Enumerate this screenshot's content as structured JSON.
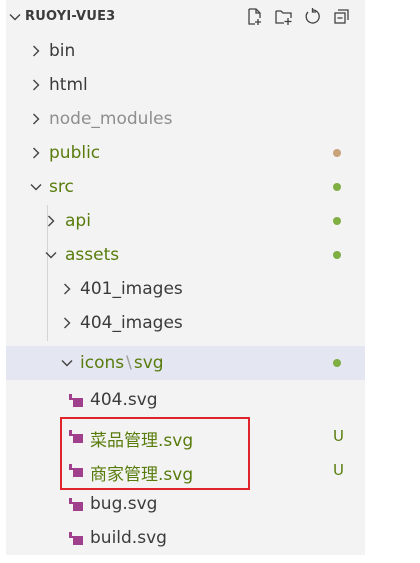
{
  "explorer": {
    "title": "RUOYI-VUE3",
    "header_actions": [
      "new-file-icon",
      "new-folder-icon",
      "refresh-icon",
      "collapse-all-icon"
    ],
    "colors": {
      "untracked": "#587c0c",
      "ignored": "#8e8e90",
      "modified_dot_brown": "#c8a27a",
      "svg_icon": "#a0408c",
      "highlight_box": "#e0242c"
    }
  },
  "tree": [
    {
      "label": "bin",
      "type": "folder",
      "expanded": false
    },
    {
      "label": "html",
      "type": "folder",
      "expanded": false
    },
    {
      "label": "node_modules",
      "type": "folder",
      "expanded": false
    },
    {
      "label": "public",
      "type": "folder",
      "expanded": false
    },
    {
      "label": "src",
      "type": "folder",
      "expanded": true
    },
    {
      "label": "api",
      "type": "folder",
      "expanded": false
    },
    {
      "label": "assets",
      "type": "folder",
      "expanded": true
    },
    {
      "label": "401_images",
      "type": "folder",
      "expanded": false
    },
    {
      "label": "404_images",
      "type": "folder",
      "expanded": false
    },
    {
      "label_a": "icons",
      "label_b": "svg",
      "type": "folder",
      "expanded": true
    },
    {
      "label": "404.svg",
      "type": "file"
    },
    {
      "label": "菜品管理.svg",
      "type": "file",
      "status": "U"
    },
    {
      "label": "商家管理.svg",
      "type": "file",
      "status": "U"
    },
    {
      "label": "bug.svg",
      "type": "file"
    },
    {
      "label": "build.svg",
      "type": "file"
    }
  ]
}
